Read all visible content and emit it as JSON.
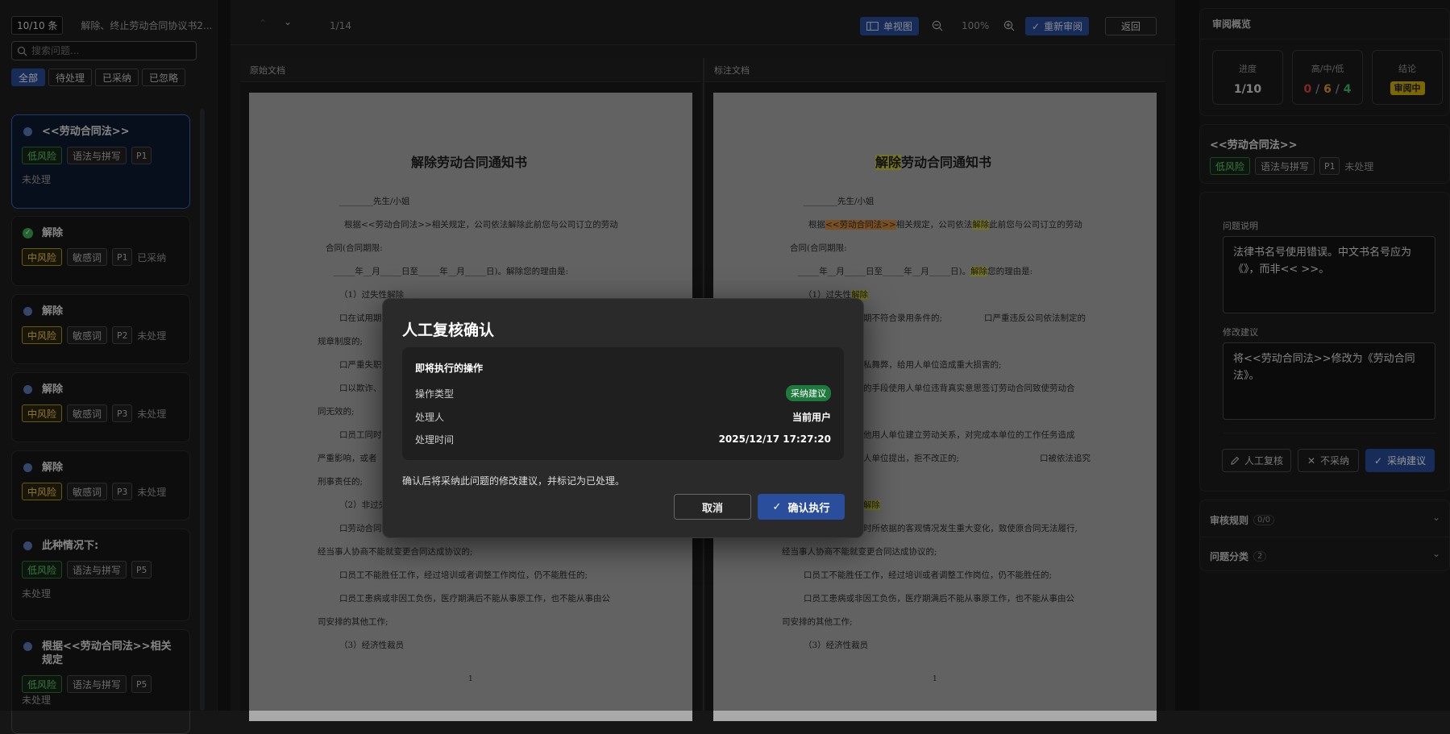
{
  "left": {
    "count": "10/10 条",
    "doc_name": "解除、终止劳动合同协议书2...",
    "search_placeholder": "搜索问题...",
    "filters": [
      "全部",
      "待处理",
      "已采纳",
      "已忽略"
    ],
    "cards": [
      {
        "title": "<<劳动合同法>>",
        "risk": "低风险",
        "category": "语法与拼写",
        "page": "P1",
        "status": "未处理",
        "done": false
      },
      {
        "title": "解除",
        "risk": "中风险",
        "category": "敏感词",
        "page": "P1",
        "status": "已采纳",
        "done": true
      },
      {
        "title": "解除",
        "risk": "中风险",
        "category": "敏感词",
        "page": "P2",
        "status": "未处理",
        "done": false
      },
      {
        "title": "解除",
        "risk": "中风险",
        "category": "敏感词",
        "page": "P3",
        "status": "未处理",
        "done": false
      },
      {
        "title": "解除",
        "risk": "中风险",
        "category": "敏感词",
        "page": "P3",
        "status": "未处理",
        "done": false
      },
      {
        "title": "此种情况下:",
        "risk": "低风险",
        "category": "语法与拼写",
        "page": "P5",
        "status": "未处理",
        "done": false
      },
      {
        "title": "根据<<劳动合同法>>相关规定",
        "risk": "低风险",
        "category": "语法与拼写",
        "page": "P5",
        "status": "未处理",
        "done": false
      }
    ]
  },
  "toolbar": {
    "page_indicator": "1/14",
    "single_view": "单视图",
    "zoom": "100%",
    "re_review": "重新审阅",
    "back": "返回"
  },
  "panes": {
    "original": "原始文档",
    "annotated": "标注文档"
  },
  "document": {
    "title_hl": "解除",
    "title_rest": "劳动合同通知书",
    "title_full": "解除劳动合同通知书",
    "salutation": "________先生/小姐",
    "p1a": "根据",
    "p1b": "<<劳动合同法>>",
    "p1c": "相关规定，公司依法",
    "p1d": "解除",
    "p1e": "此前您与公司订立的劳动",
    "p1_full": "根据<<劳动合同法>>相关规定，公司依法解除此前您与公司订立的劳动",
    "p2": "合同(合同期限:",
    "p3a": "_____年__月_____日至_____年__月_____日)。",
    "p3b": "解除",
    "p3c": "您的理由是:",
    "p3_full": "_____年__月_____日至_____年__月_____日)。解除您的理由是:",
    "s1a": "（1）过失性",
    "s1b": "解除",
    "l_a": "口在试用期",
    "r_a": "期不符合录用条件的;",
    "r_a2": "口严重违反公司依法制定的",
    "l_b": "规章制度的;",
    "l_c": "口严重失职",
    "r_c": "私舞弊，给用人单位造成重大损害的;",
    "l_d": "口以欺诈、",
    "r_d": "的手段使用人单位违背真实意思签订劳动合同致使劳动合",
    "l_e": "同无效的;",
    "l_f": "口员工同时",
    "r_f": "他用人单位建立劳动关系，对完成本单位的工作任务造成",
    "l_g": "严重影响，或者",
    "r_g": "人单位提出，拒不改正的;",
    "r_g2": "口被依法追究",
    "l_h": "刑事责任的;",
    "l_i": "（2）非过失",
    "r_i": "解除",
    "l_j": "口劳动合同",
    "r_j": "时所依据的客观情况发生重大变化，致使原合同无法履行,",
    "k": "经当事人协商不能就变更合同达成协议的;",
    "m": "口员工不能胜任工作，经过培训或者调整工作岗位，仍不能胜任的;",
    "n": "口员工患病或非因工负伤，医疗期满后不能从事原工作，也不能从事由公",
    "o": "司安排的其他工作;",
    "q": "（3）经济性裁员",
    "page_no": "1"
  },
  "right": {
    "overview_title": "审阅概览",
    "progress_label": "进度",
    "progress_value": "1/10",
    "hml_label": "高/中/低",
    "high": "0",
    "mid": "6",
    "low": "4",
    "sep": "/",
    "conclusion_label": "结论",
    "conclusion_value": "审阅中",
    "issue_title": "<<劳动合同法>>",
    "issue_risk": "低风险",
    "issue_category": "语法与拼写",
    "issue_page": "P1",
    "issue_status": "未处理",
    "desc_label": "问题说明",
    "desc_text": "法律书名号使用错误。中文书名号应为《》，而非<< >>。",
    "suggest_label": "修改建议",
    "suggest_text": "将<<劳动合同法>>修改为《劳动合同法》。",
    "btn_manual": "人工复核",
    "btn_reject": "不采纳",
    "btn_accept": "采纳建议",
    "rules_label": "审核规则",
    "rules_count": "0/0",
    "cats_label": "问题分类",
    "cats_count": "2"
  },
  "modal": {
    "title": "人工复核确认",
    "box_title": "即将执行的操作",
    "op_label": "操作类型",
    "op_value": "采纳建议",
    "handler_label": "处理人",
    "handler_value": "当前用户",
    "time_label": "处理时间",
    "time_value": "2025/12/17 17:27:20",
    "note": "确认后将采纳此问题的修改建议，并标记为已处理。",
    "cancel": "取消",
    "confirm": "确认执行"
  },
  "colors": {
    "accent": "#2a4d9c",
    "high": "#e0453a",
    "mid": "#e89a2c",
    "low": "#3bbf6a",
    "badge": "#d4b400"
  }
}
